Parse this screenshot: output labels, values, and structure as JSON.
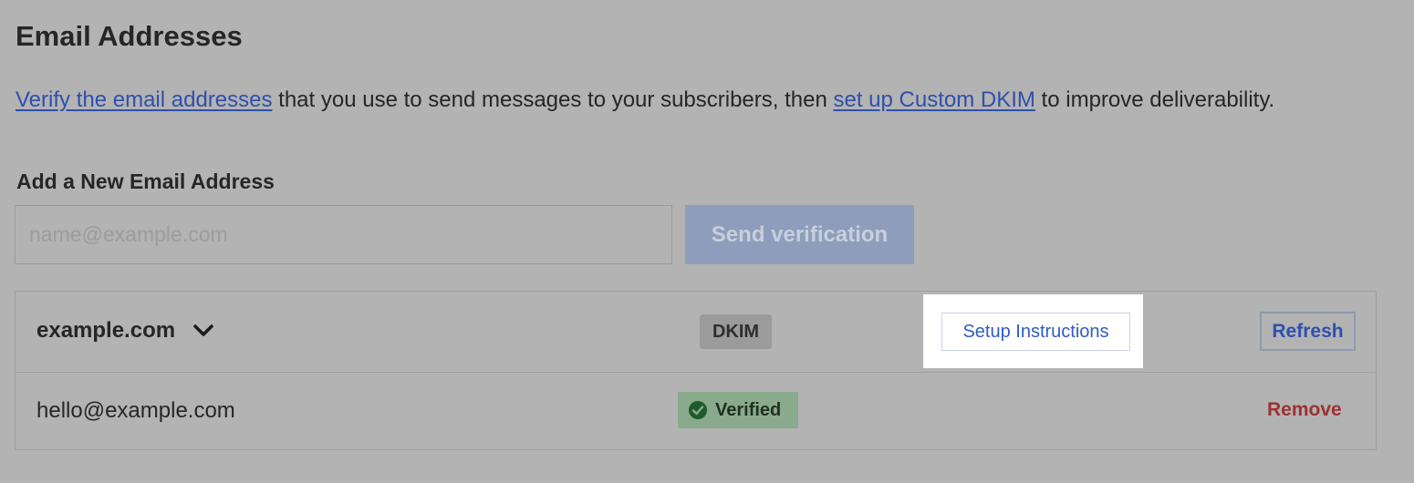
{
  "page": {
    "title": "Email Addresses"
  },
  "intro": {
    "link1": "Verify the email addresses",
    "text1": " that you use to send messages to your subscribers, then ",
    "link2": "set up Custom DKIM",
    "text2": " to improve deliverability."
  },
  "add_form": {
    "heading": "Add a New Email Address",
    "input_value": "",
    "input_placeholder": "name@example.com",
    "submit_label": "Send verification"
  },
  "domain": {
    "name": "example.com",
    "expand_icon": "chevron-down-icon",
    "dkim_label": "DKIM",
    "setup_label": "Setup Instructions",
    "refresh_label": "Refresh",
    "emails": [
      {
        "address": "hello@example.com",
        "status": "Verified",
        "status_icon": "check-circle-icon",
        "remove_label": "Remove"
      }
    ]
  },
  "colors": {
    "link": "#2f4fae",
    "verified_badge": "#8aaa8d",
    "remove": "#9b3232",
    "highlight": "#ffffff"
  }
}
